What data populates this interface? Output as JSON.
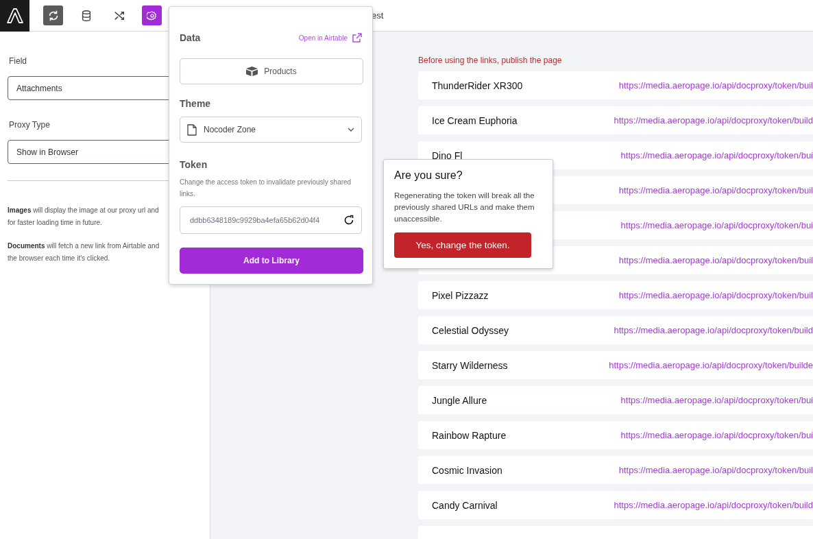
{
  "toolbar": {
    "buttons": [
      {
        "kind": "sync",
        "highlighted": true,
        "selected": false
      },
      {
        "kind": "database",
        "highlighted": false,
        "selected": false
      },
      {
        "kind": "shuffle",
        "highlighted": false,
        "selected": false
      },
      {
        "kind": "settings",
        "highlighted": false,
        "selected": true
      }
    ],
    "tab_text": "est"
  },
  "sidebar": {
    "fields": [
      {
        "label": "Field",
        "value": "Attachments"
      },
      {
        "label": "Proxy Type",
        "value": "Show in Browser"
      }
    ],
    "notes": [
      "**Images** will display the image at our proxy url and for faster loading time in future.",
      "**Documents** will fetch a new link from Airtable and the browser each time it's clicked."
    ]
  },
  "notice": "Before using the links, publish the page",
  "links": [
    {
      "name": "ThunderRider XR300",
      "url": "https://media.aeropage.io/api/docproxy/token/buil"
    },
    {
      "name": "Ice Cream Euphoria",
      "url": "https://media.aeropage.io/api/docproxy/token/build"
    },
    {
      "name": "Dino Fl",
      "url": "https://media.aeropage.io/api/docproxy/token/bui"
    },
    {
      "url": "https://media.aeropage.io/api/docproxy/token/buil"
    },
    {
      "url": "https://media.aeropage.io/api/docproxy/token/bui"
    },
    {
      "url": "https://media.aeropage.io/api/docproxy/token/buil"
    },
    {
      "name": "Pixel Pizzazz",
      "url": "https://media.aeropage.io/api/docproxy/token/buil"
    },
    {
      "name": "Celestial Odyssey",
      "url": "https://media.aeropage.io/api/docproxy/token/build"
    },
    {
      "name": "Starry Wilderness",
      "url": "https://media.aeropage.io/api/docproxy/token/builde"
    },
    {
      "name": "Jungle Allure",
      "url": "https://media.aeropage.io/api/docproxy/token/bui"
    },
    {
      "name": "Rainbow Rapture",
      "url": "https://media.aeropage.io/api/docproxy/token/bui"
    },
    {
      "name": "Cosmic Invasion",
      "url": "https://media.aeropage.io/api/docproxy/token/buil"
    },
    {
      "name": "Candy Carnival",
      "url": "https://media.aeropage.io/api/docproxy/token/build"
    }
  ],
  "popover": {
    "data": {
      "heading": "Data",
      "link": "Open in Airtable",
      "table": "Products"
    },
    "theme": {
      "heading": "Theme",
      "value": "Nocoder Zone"
    },
    "token": {
      "heading": "Token",
      "help": "Change the access token to invalidate previously shared links.",
      "value": "ddbb6348189c9929ba4efa65b62d04f4"
    },
    "submit": "Add to Library"
  },
  "confirm": {
    "title": "Are you sure?",
    "message": "Regenerating the token will break all the previously shared URLs and make them unaccessible.",
    "button": "Yes, change the token."
  }
}
